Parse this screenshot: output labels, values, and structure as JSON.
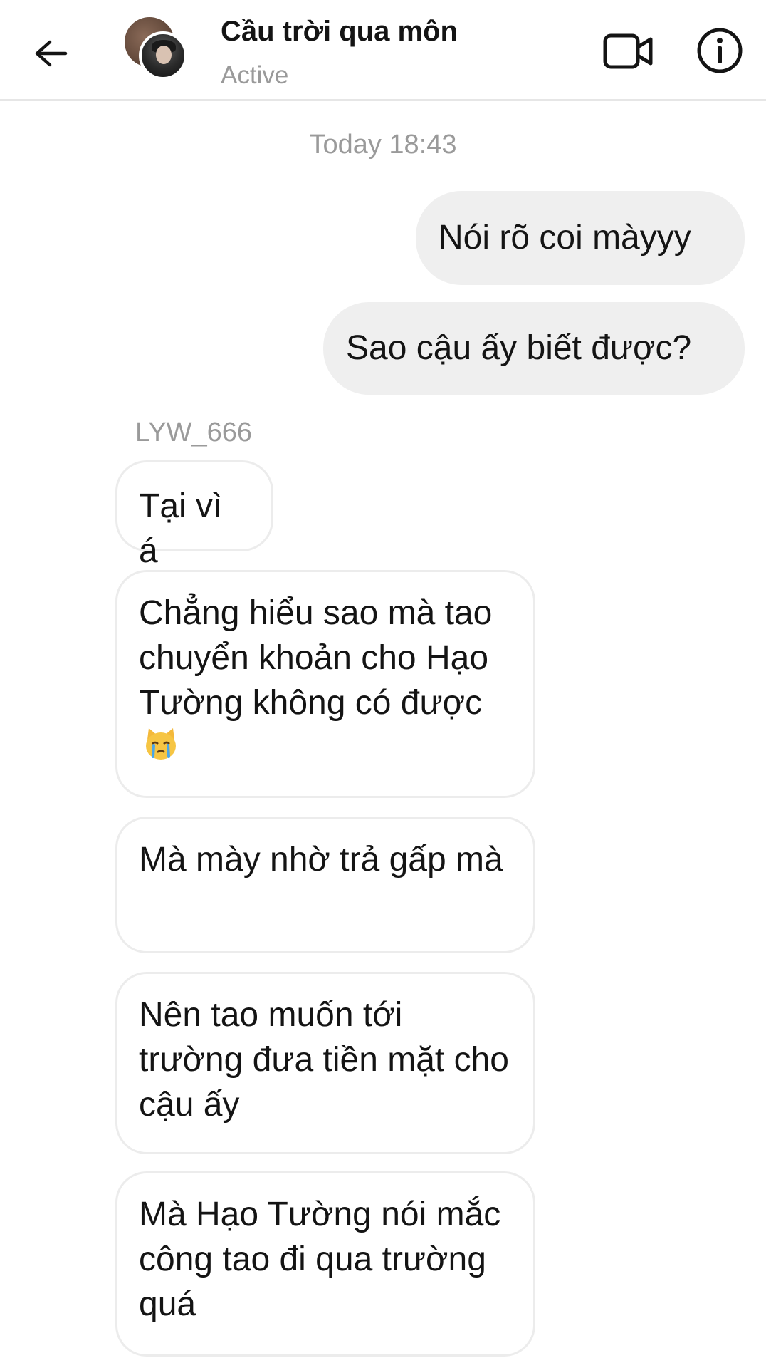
{
  "header": {
    "title": "Cầu trời qua môn",
    "status": "Active",
    "icons": {
      "back": "back-arrow-icon",
      "video": "video-camera-icon",
      "info": "info-icon"
    }
  },
  "conversation": {
    "timestamp": "Today 18:43",
    "outgoing": [
      {
        "text": "Nói rõ coi màyyy"
      },
      {
        "text": "Sao cậu ấy biết được?"
      }
    ],
    "sender_name": "LYW_666",
    "incoming": [
      {
        "text": "Tại vì á"
      },
      {
        "text": "Chẳng hiểu sao mà tao chuyển khoản cho Hạo Tường không có được",
        "emoji": "crying-cat-emoji"
      },
      {
        "text": "Mà mày nhờ trả gấp mà"
      },
      {
        "text": "Nên tao muốn tới trường đưa tiền mặt cho cậu ấy"
      },
      {
        "text": "Mà Hạo Tường nói mắc công tao đi qua trường quá"
      }
    ]
  },
  "colors": {
    "outgoing_bubble": "#efefef",
    "incoming_border": "#ececec",
    "muted_text": "#9a9a9a",
    "text": "#141414"
  }
}
